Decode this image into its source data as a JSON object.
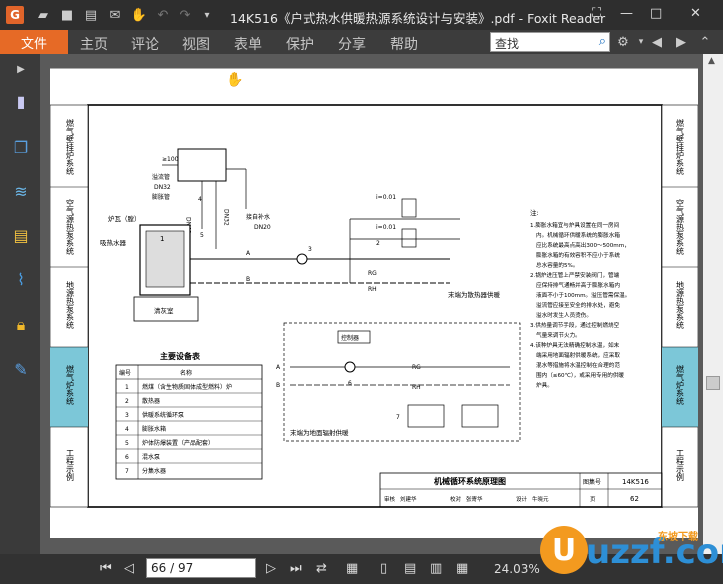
{
  "window": {
    "title": "14K516《户式热水供暖热源系统设计与安装》.pdf - Foxit Reader",
    "app_logo": "G"
  },
  "menu": {
    "file": "文件",
    "items": [
      "主页",
      "评论",
      "视图",
      "表单",
      "保护",
      "分享",
      "帮助"
    ]
  },
  "search": {
    "placeholder": "查找"
  },
  "sidebar": {
    "icons": [
      "page-icon",
      "layers-icon",
      "stack-icon",
      "comment-icon",
      "attachment-icon",
      "lock-icon",
      "pen-icon"
    ]
  },
  "status": {
    "page_display": "66 / 97",
    "zoom": "24.03%"
  },
  "watermark": {
    "brand": "uzzf.com",
    "sub": "东坡下载"
  },
  "drawing": {
    "side_tabs": [
      "燃气壁挂炉系统",
      "空气源热泵系统",
      "地源热泵系统",
      "燃气炉系统",
      "工程示例"
    ],
    "labels": {
      "overflow": "溢流管",
      "dn32": "DN32",
      "expansion": "膨胀管",
      "dn40": "DN40",
      "dn32b": "DN32",
      "makeup": "接自补水",
      "dn20": "DN20",
      "h100": "≥100",
      "furnace": "炉瓦（膛）",
      "tank": "吸热水器",
      "room": "清灰室",
      "radiator_end": "末端为散热器供暖",
      "floor_end": "末端为地面辐射供暖",
      "controller": "控制器",
      "i1": "i=0.01",
      "i2": "i=0.01",
      "rg": "RG",
      "rh": "RH",
      "rg2": "RG",
      "rh2": "RH",
      "a": "A",
      "b": "B",
      "a2": "A",
      "b2": "B"
    },
    "table": {
      "title": "主要设备表",
      "headers": [
        "编号",
        "名称"
      ],
      "rows": [
        [
          "1",
          "燃煤（含生物质固体成型燃料）炉"
        ],
        [
          "2",
          "散热器"
        ],
        [
          "3",
          "供暖系统循环泵"
        ],
        [
          "4",
          "膨胀水箱"
        ],
        [
          "5",
          "炉体防爆装置（产品配套）"
        ],
        [
          "6",
          "混水泵"
        ],
        [
          "7",
          "分集水器"
        ]
      ]
    },
    "notes_title": "注:",
    "notes": [
      "1.膨胀水箱宜与炉具设置在同一房间",
      "内。机械循环供暖系统的膨胀水箱",
      "应比系统最高点高出300～500mm，",
      "膨胀水箱的有效容积不应小于系统",
      "总水容量的5%。",
      "2.锅炉进压管上严禁安装阀门，管端",
      "应保持排气通畅并高于膨胀水箱内",
      "液面不小于100mm。溢压管需保温。",
      "溢流管应接至安全的排水处，避免",
      "溢水时发生人员烫伤。",
      "3.供热量调节手段，通过控制燃烧空",
      "气量来调节火力。",
      "4.该种炉具无法精确控制水温，如末",
      "端采用地面辐射供暖系统，应采取",
      "混水等措施将水温控制在合理的范",
      "围内（≤60℃），或采用专用的供暖",
      "炉具。"
    ],
    "title_block": {
      "drawing_title": "机械循环系统原理图",
      "atlas_label": "图集号",
      "atlas_no": "14K516",
      "row2": [
        "审核",
        "刘建华",
        "校对",
        "张寄华",
        "设计",
        "牛晓元",
        "页"
      ],
      "page_no": "62"
    },
    "callouts": [
      "1",
      "2",
      "3",
      "4",
      "5",
      "6",
      "7"
    ]
  }
}
